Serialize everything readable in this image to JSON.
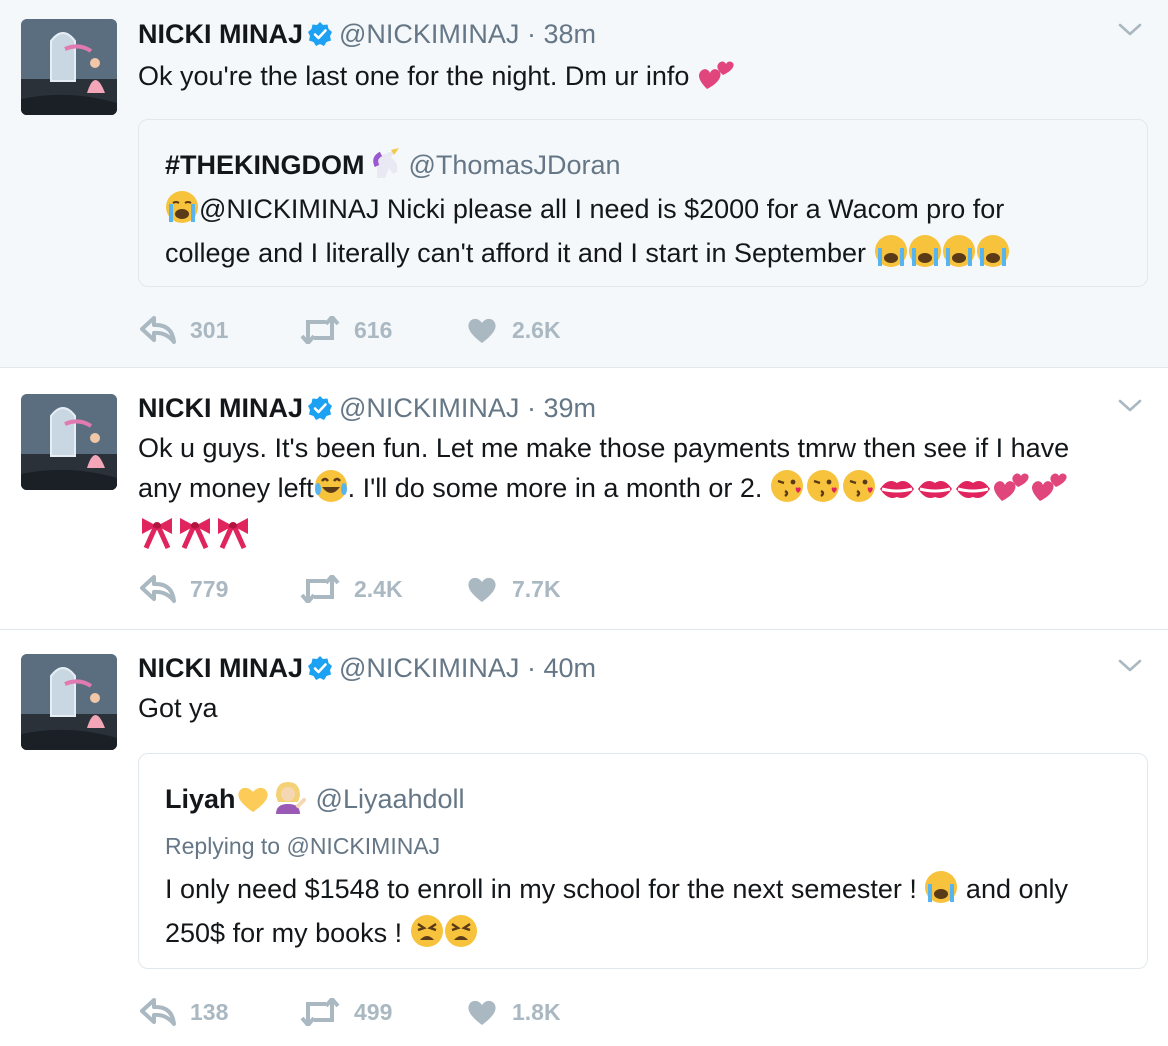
{
  "tweets": [
    {
      "name": "NICKI MINAJ",
      "handle": "@NICKIMINAJ",
      "separator": "·",
      "time": "38m",
      "text": "Ok you're the last one for the night. Dm ur info",
      "quote": {
        "name": "#THEKINGDOM",
        "handle": "@ThomasJDoran",
        "text_line1": "@NICKIMINAJ Nicki please all I need is $2000 for a Wacom pro for",
        "text_line2": "college and I literally can't afford it and I start in September"
      },
      "replies": "301",
      "retweets": "616",
      "likes": "2.6K"
    },
    {
      "name": "NICKI MINAJ",
      "handle": "@NICKIMINAJ",
      "separator": "·",
      "time": "39m",
      "text_line1": "Ok u guys. It's been fun. Let me make those payments tmrw then see if I have",
      "text_line2a": "any money left",
      "text_line2b": ". I'll do some more in a month or 2. ",
      "replies": "779",
      "retweets": "2.4K",
      "likes": "7.7K"
    },
    {
      "name": "NICKI MINAJ",
      "handle": "@NICKIMINAJ",
      "separator": "·",
      "time": "40m",
      "text": "Got ya",
      "quote": {
        "name": "Liyah",
        "handle": "@Liyaahdoll",
        "reply_prefix": "Replying to ",
        "reply_handle": "@NICKIMINAJ",
        "text_line1a": "I only need $1548 to enroll in my school for the next semester ! ",
        "text_line1b": " and only",
        "text_line2": "250$ for my books ! "
      },
      "replies": "138",
      "retweets": "499",
      "likes": "1.8K"
    }
  ],
  "icons": {
    "verified": "verified-badge-icon",
    "chevron": "chevron-down-icon",
    "reply": "reply-icon",
    "retweet": "retweet-icon",
    "like": "heart-icon"
  },
  "colors": {
    "accent": "#1da1f2",
    "muted": "#657786",
    "action_gray": "#aab8c2",
    "highlight_bg": "#f5f8fa",
    "border": "#e1e8ed"
  }
}
